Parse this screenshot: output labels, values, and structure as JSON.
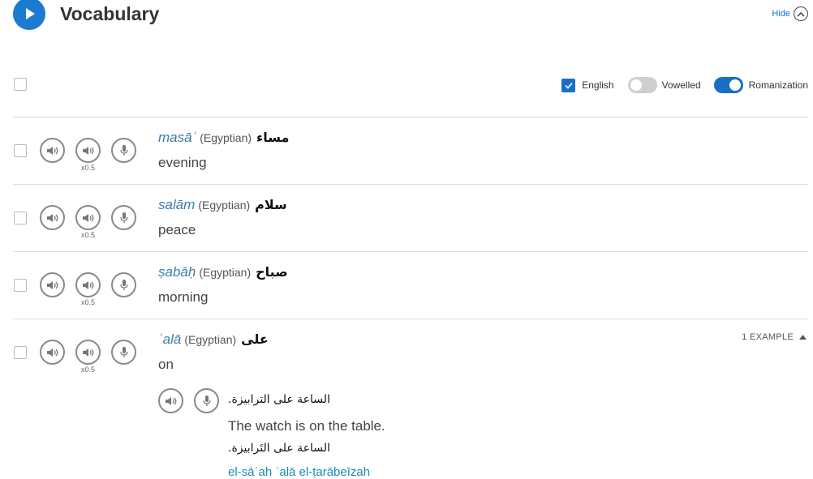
{
  "header": {
    "title": "Vocabulary",
    "hide_label": "Hide"
  },
  "icons": {
    "play": "play-icon",
    "hide": "chevron-up-icon",
    "audio": "speaker-icon",
    "record": "microphone-icon",
    "expand": "caret-up-icon",
    "check": "checkmark-icon"
  },
  "toolbar": {
    "english_label": "English",
    "english_checked": true,
    "vowelled_label": "Vowelled",
    "vowelled_on": false,
    "romanization_label": "Romanization",
    "romanization_on": true
  },
  "colors": {
    "accent": "#1a6fc4",
    "romanization_text": "#3d7da8",
    "example_romanization": "#1a8ab3"
  },
  "vocab": [
    {
      "roman": "masāʾ",
      "dialect": "(Egyptian)",
      "arabic": "مساء",
      "english": "evening",
      "slow_label": "x0.5"
    },
    {
      "roman": "salām",
      "dialect": "(Egyptian)",
      "arabic": "سلام",
      "english": "peace",
      "slow_label": "x0.5"
    },
    {
      "roman": "ṣabāḥ",
      "dialect": "(Egyptian)",
      "arabic": "صباح",
      "english": "morning",
      "slow_label": "x0.5"
    },
    {
      "roman": "ʿalā",
      "dialect": "(Egyptian)",
      "arabic": "على",
      "english": "on",
      "slow_label": "x0.5",
      "examples_label": "1 EXAMPLE"
    }
  ],
  "example": {
    "arabic": "الساعة على الترابيزة.",
    "arabic_vowelled": "الساعة على التَرابيزة.",
    "english": "The watch is on the table.",
    "romanization": "el-sāʿah ʿalā el-ṭarābeīzah"
  }
}
